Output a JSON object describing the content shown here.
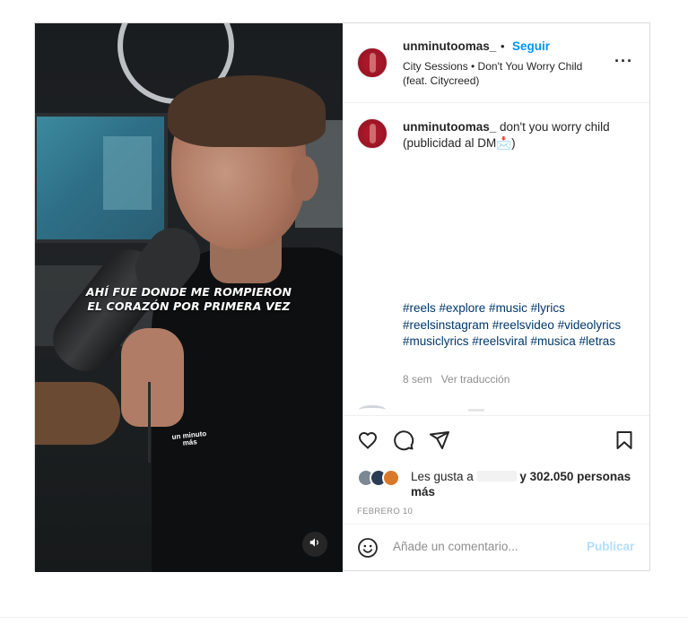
{
  "post": {
    "username": "unminutoomas_",
    "dot": "•",
    "follow_label": "Seguir",
    "audio_line1": "City Sessions • Don't You Worry Child",
    "audio_line2": "(feat. Citycreed)",
    "more_icon": "more-horizontal-icon"
  },
  "video": {
    "lyric_line1": "AHÍ FUE DONDE ME ROMPIERON",
    "lyric_line2": "EL CORAZÓN POR PRIMERA VEZ",
    "watermark_line1": "un minuto",
    "watermark_line2": "más",
    "sound_icon": "speaker-icon"
  },
  "caption": {
    "username": "unminutoomas_",
    "text": " don't you worry child (publicidad al DM📩)",
    "hashtags": "#reels #explore #music #lyrics #reelsinstagram #reelsvideo #videolyrics #musiclyrics #reelsviral #musica #letras",
    "age": "8 sem",
    "translate_label": "Ver traducción"
  },
  "actions": {
    "like_icon": "heart-icon",
    "comment_icon": "comment-icon",
    "share_icon": "send-icon",
    "save_icon": "bookmark-icon",
    "likes_prefix": "Les gusta a",
    "likes_suffix": " y 302.050 personas",
    "likes_line2": "más",
    "date": "FEBRERO 10"
  },
  "comment": {
    "emoji_icon": "smiley-icon",
    "placeholder": "Añade un comentario...",
    "publish_label": "Publicar"
  },
  "colors": {
    "accent": "#0095f6",
    "publish_disabled": "#b2dffc",
    "hashtag": "#00376b",
    "muted": "#8e8e8e",
    "border": "#dbdbdb"
  }
}
